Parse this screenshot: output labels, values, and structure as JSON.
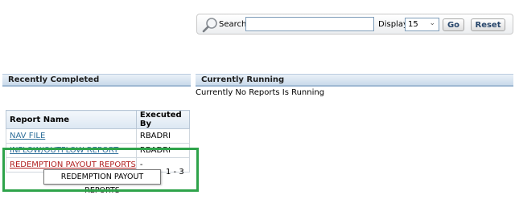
{
  "search": {
    "label": "Search",
    "value": "",
    "display_label": "Display",
    "display_value": "15",
    "go_label": "Go",
    "reset_label": "Reset"
  },
  "sections": {
    "completed_title": "Recently Completed",
    "running_title": "Currently Running",
    "running_message": "Currently No Reports Is Running"
  },
  "table": {
    "columns": [
      "Report Name",
      "Executed By"
    ],
    "rows": [
      {
        "name": "NAV FILE",
        "executed_by": "RBADRI"
      },
      {
        "name": "INFLOW/OUTFLOW REPORT",
        "executed_by": "RBADRI"
      },
      {
        "name": "REDEMPTION PAYOUT REPORTS",
        "executed_by": "-"
      }
    ]
  },
  "tooltip": "REDEMPTION PAYOUT REPORTS",
  "pagination": "1 - 3",
  "colors": {
    "highlight": "#2ea34a",
    "link": "#2f6f9a",
    "link_hover": "#b22222"
  },
  "icons": {
    "search": "magnifier-icon",
    "display_dropdown": "chevron-down-icon"
  }
}
